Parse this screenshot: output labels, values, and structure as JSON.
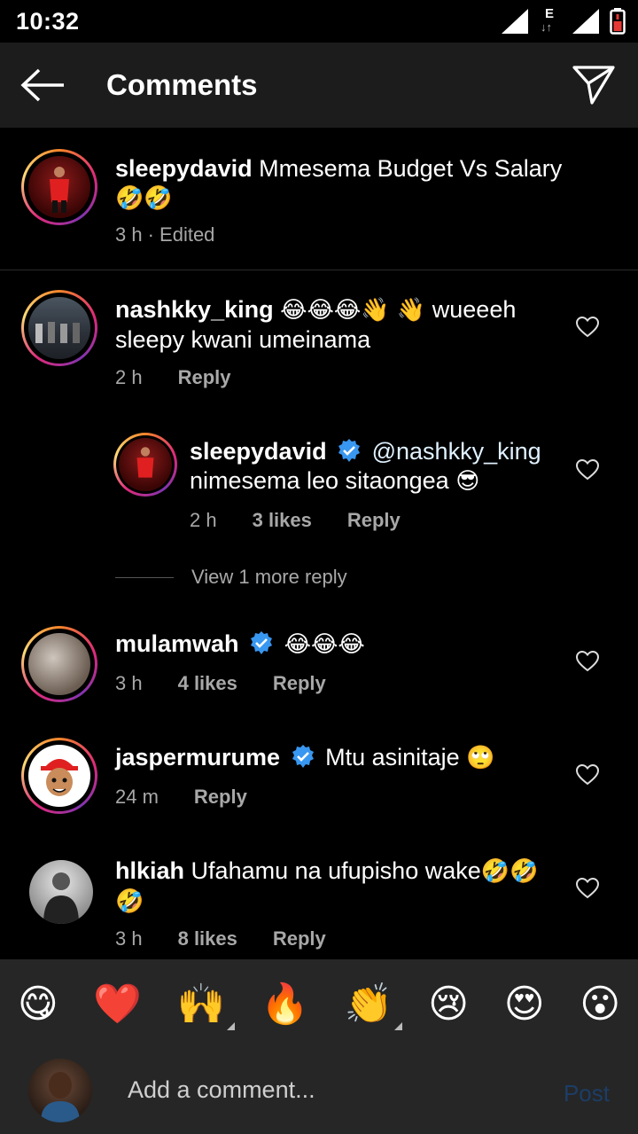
{
  "status_bar": {
    "time": "10:32",
    "network_label": "E"
  },
  "app_bar": {
    "title": "Comments"
  },
  "caption": {
    "user": "sleepydavid",
    "text": "Mmesema Budget Vs Salary",
    "emoji": "🤣🤣",
    "time": "3 h",
    "edited": "· Edited"
  },
  "comments": [
    {
      "user": "nashkky_king",
      "emoji_prefix": "😂😂😂👋 👋",
      "text": "wueeeh",
      "line2": "sleepy kwani umeinama",
      "time": "2 h",
      "likes": "",
      "reply": "Reply"
    },
    {
      "user": "sleepydavid",
      "mention": "@nashkky_king",
      "text": "nimesema leo sitaongea",
      "emoji": "😎",
      "time": "2 h",
      "likes": "3 likes",
      "reply": "Reply"
    },
    {
      "user": "mulamwah",
      "emoji": "😂😂😂",
      "time": "3 h",
      "likes": "4 likes",
      "reply": "Reply"
    },
    {
      "user": "jaspermurume",
      "text": "Mtu asinitaje",
      "emoji": "🙄",
      "time": "24 m",
      "reply": "Reply"
    },
    {
      "user": "hlkiah",
      "text": "Ufahamu na ufupisho wake",
      "emoji": "🤣🤣",
      "emoji2": "🤣",
      "time": "3 h",
      "likes": "8 likes",
      "reply": "Reply"
    }
  ],
  "view_more": "View 1 more reply",
  "quick_emojis": [
    "😋",
    "❤️",
    "🙌",
    "🔥",
    "👏",
    "😢",
    "😍",
    "😮"
  ],
  "composer": {
    "placeholder": "Add a comment...",
    "post_label": "Post"
  },
  "colors": {
    "background": "#000000",
    "app_bar": "#1c1c1c",
    "verified": "#3897f0",
    "post_disabled": "#1c3d66"
  }
}
